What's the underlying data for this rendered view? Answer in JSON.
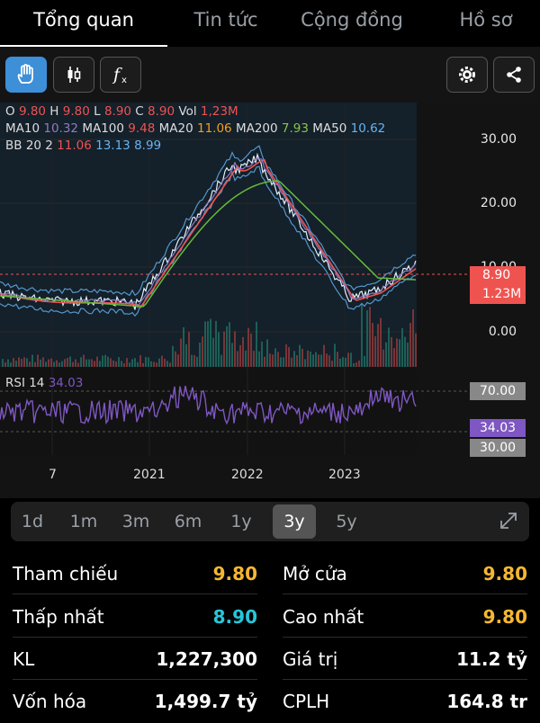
{
  "tabs": [
    {
      "label": "Tổng quan"
    },
    {
      "label": "Tin tức"
    },
    {
      "label": "Cộng đồng"
    },
    {
      "label": "Hồ sơ"
    }
  ],
  "toolbar": {
    "tools": [
      "hand-pointer-icon",
      "candlestick-icon",
      "function-icon"
    ],
    "right": [
      "gear-icon",
      "share-icon"
    ]
  },
  "legend": {
    "ohlc": [
      {
        "k": "O",
        "v": "9.80"
      },
      {
        "k": "H",
        "v": "9.80"
      },
      {
        "k": "L",
        "v": "8.90"
      },
      {
        "k": "C",
        "v": "8.90"
      },
      {
        "k": "Vol",
        "v": "1,23M"
      }
    ],
    "ma": [
      {
        "k": "MA10",
        "v": "10.32",
        "color": "#8e7cc3"
      },
      {
        "k": "MA100",
        "v": "9.48",
        "color": "#ef5350"
      },
      {
        "k": "MA20",
        "v": "11.06",
        "color": "#f0a020"
      },
      {
        "k": "MA200",
        "v": "7.93",
        "color": "#8bc34a"
      },
      {
        "k": "MA50",
        "v": "10.62",
        "color": "#64b5f6"
      }
    ],
    "bb": {
      "k": "BB 20 2",
      "v1": "11.06",
      "v2": "13.13",
      "v3": "8.99"
    }
  },
  "price_axis": [
    "30.00",
    "20.00",
    "10.00",
    "0.00"
  ],
  "price_tag": "8.90",
  "vol_tag": "1.23M",
  "rsi": {
    "label": "RSI 14",
    "value": "34.03",
    "upper": "70.00",
    "lower": "30.00"
  },
  "x_axis": [
    "7",
    "2021",
    "2022",
    "2023"
  ],
  "ranges": [
    {
      "label": "1d"
    },
    {
      "label": "1m"
    },
    {
      "label": "3m"
    },
    {
      "label": "6m"
    },
    {
      "label": "1y"
    },
    {
      "label": "3y"
    },
    {
      "label": "5y"
    }
  ],
  "active_range": "3y",
  "stats": {
    "left": [
      {
        "label": "Tham chiếu",
        "value": "9.80",
        "color": "#f5b731"
      },
      {
        "label": "Thấp nhất",
        "value": "8.90",
        "color": "#26c6da"
      },
      {
        "label": "KL",
        "value": "1,227,300",
        "color": "#ffffff"
      },
      {
        "label": "Vốn hóa",
        "value": "1,499.7 tỷ",
        "color": "#ffffff"
      }
    ],
    "right": [
      {
        "label": "Mở cửa",
        "value": "9.80",
        "color": "#f5b731"
      },
      {
        "label": "Cao nhất",
        "value": "9.80",
        "color": "#f5b731"
      },
      {
        "label": "Giá trị",
        "value": "11.2 tỷ",
        "color": "#ffffff"
      },
      {
        "label": "CPLH",
        "value": "164.8 tr",
        "color": "#ffffff"
      }
    ]
  },
  "colors": {
    "accent": "#3d8fd8",
    "down": "#ef5350",
    "rsi": "#7e57c2",
    "up": "#26a69a"
  }
}
